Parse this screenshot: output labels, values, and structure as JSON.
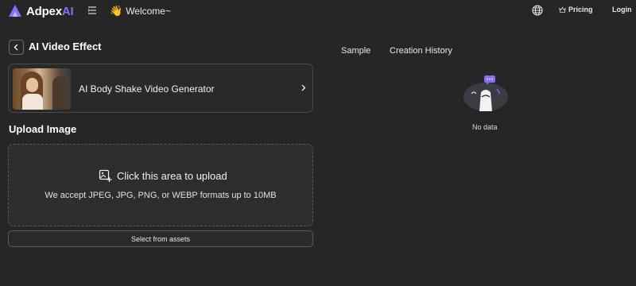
{
  "header": {
    "brand_name": "Adpex",
    "brand_suffix": "AI",
    "welcome_emoji": "👋",
    "welcome_text": "Welcome~",
    "pricing_label": "Pricing",
    "login_label": "Login",
    "icons": [
      "logo-icon",
      "menu-icon",
      "globe-icon",
      "pricing-icon"
    ]
  },
  "main": {
    "page_title": "AI Video Effect",
    "effect_card": {
      "name": "AI Body Shake Video Generator"
    },
    "upload": {
      "section_title": "Upload Image",
      "prompt": "Click this area to upload",
      "formats_note": "We accept JPEG, JPG, PNG, or WEBP formats up to 10MB",
      "assets_button": "Select from assets"
    }
  },
  "right_panel": {
    "tabs": [
      {
        "label": "Sample"
      },
      {
        "label": "Creation History"
      }
    ],
    "empty_text": "No data"
  },
  "colors": {
    "background": "#262626",
    "accent": "#8b6cf6",
    "text": "#ffffff",
    "border": "#4a4a4a"
  }
}
